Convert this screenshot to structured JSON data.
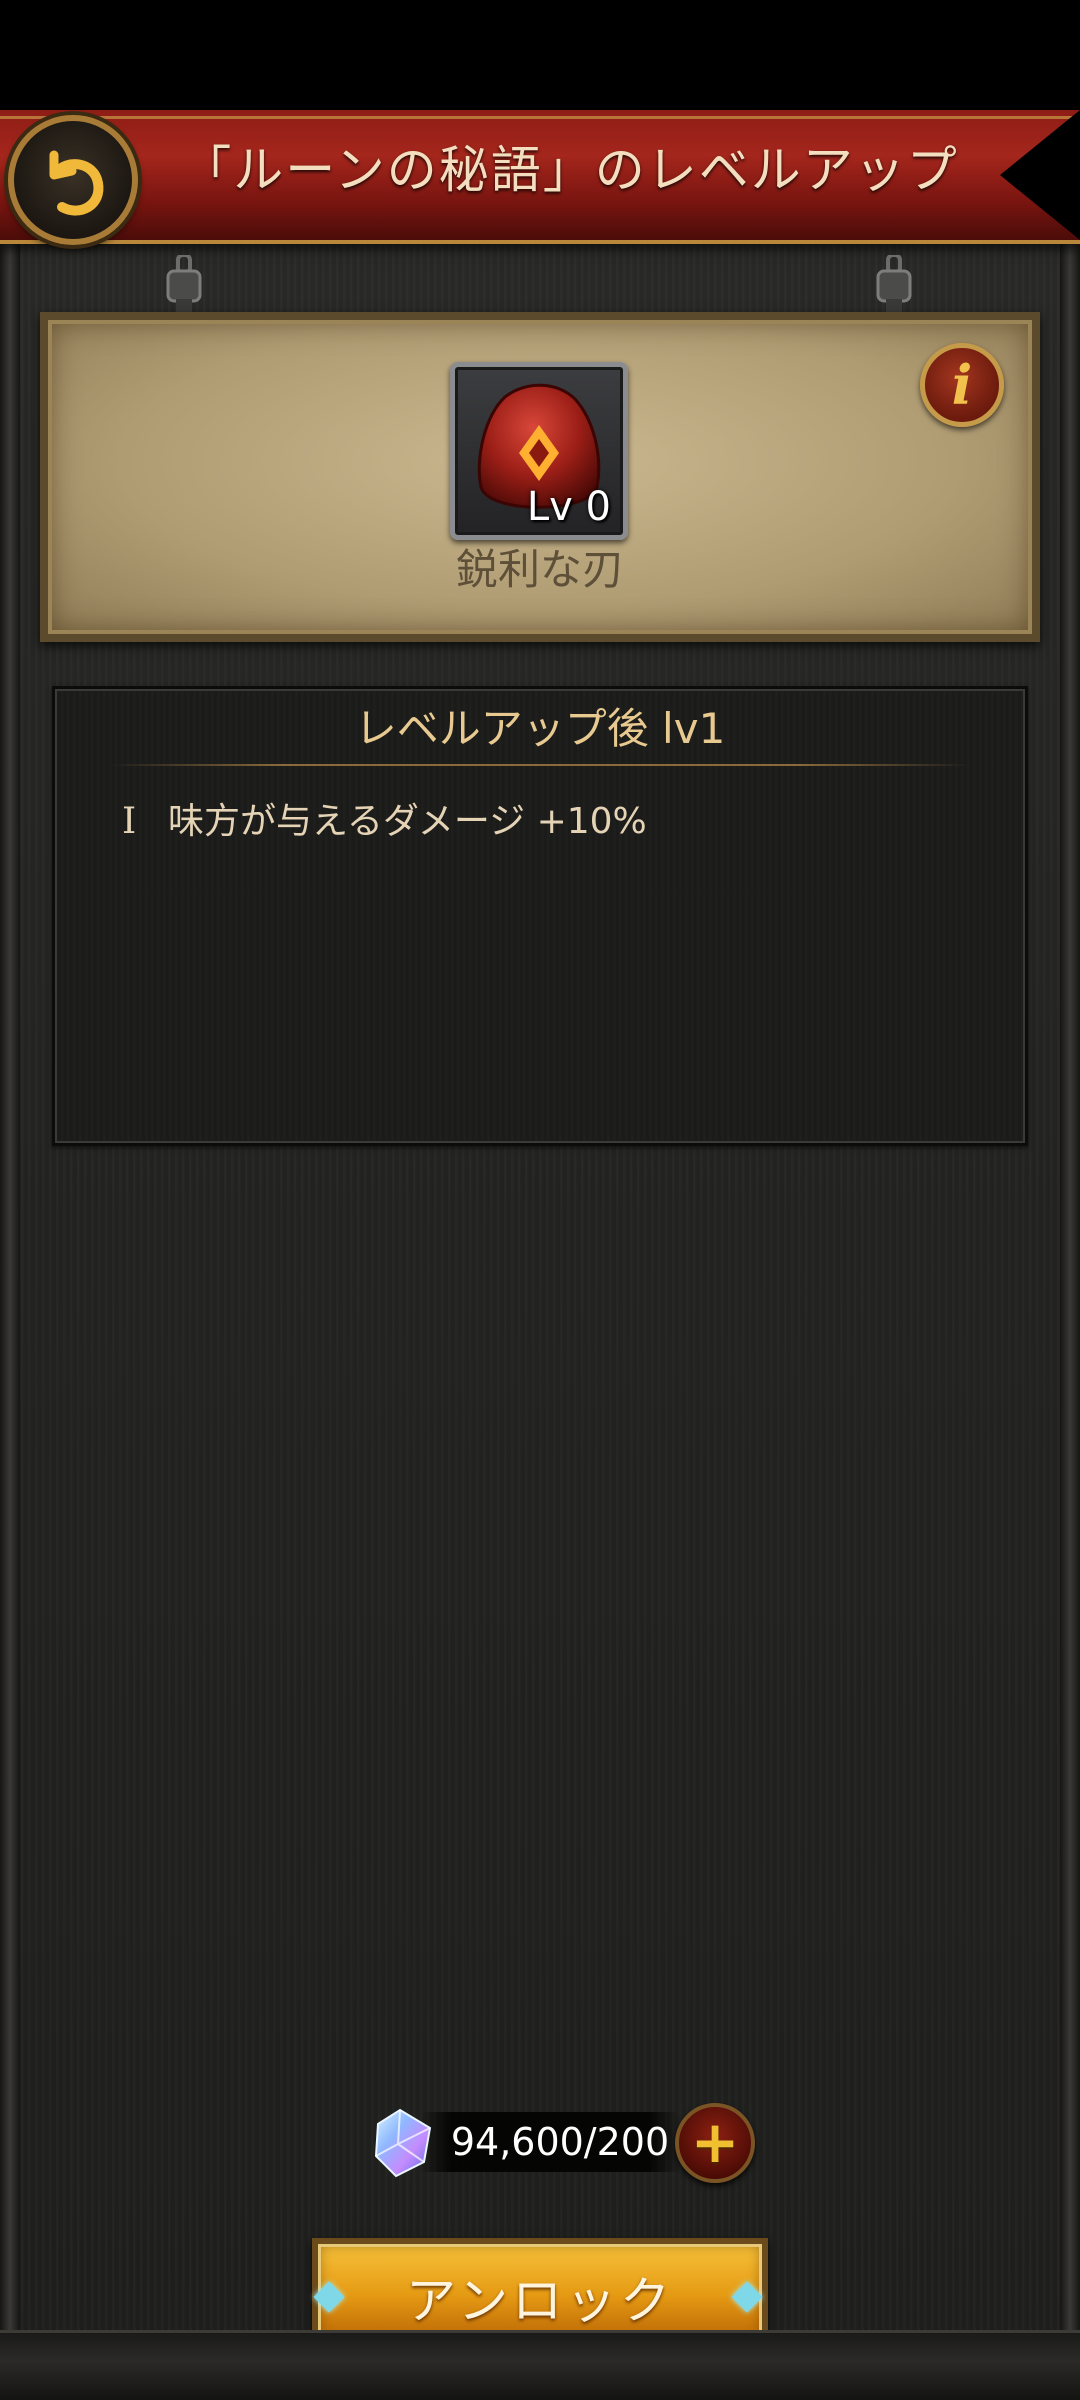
{
  "header": {
    "title": "「ルーンの秘語」のレベルアップ",
    "back_icon": "back-arrow-icon"
  },
  "rune": {
    "name": "鋭利な刃",
    "level_label": "Lv 0",
    "icon": "red-rune-stone-icon",
    "info_icon": "info-icon",
    "info_glyph": "i"
  },
  "effect": {
    "title": "レベルアップ後 lv1",
    "lines": [
      {
        "numeral": "I",
        "text": "味方が与えるダメージ +10%"
      }
    ]
  },
  "cost": {
    "icon": "crystal-icon",
    "value": "94,600/200",
    "add_glyph": "+"
  },
  "actions": {
    "unlock_label": "アンロック"
  },
  "colors": {
    "header_red": "#a4261c",
    "gold_text": "#e8c98f",
    "button_gold": "#e59a13"
  }
}
